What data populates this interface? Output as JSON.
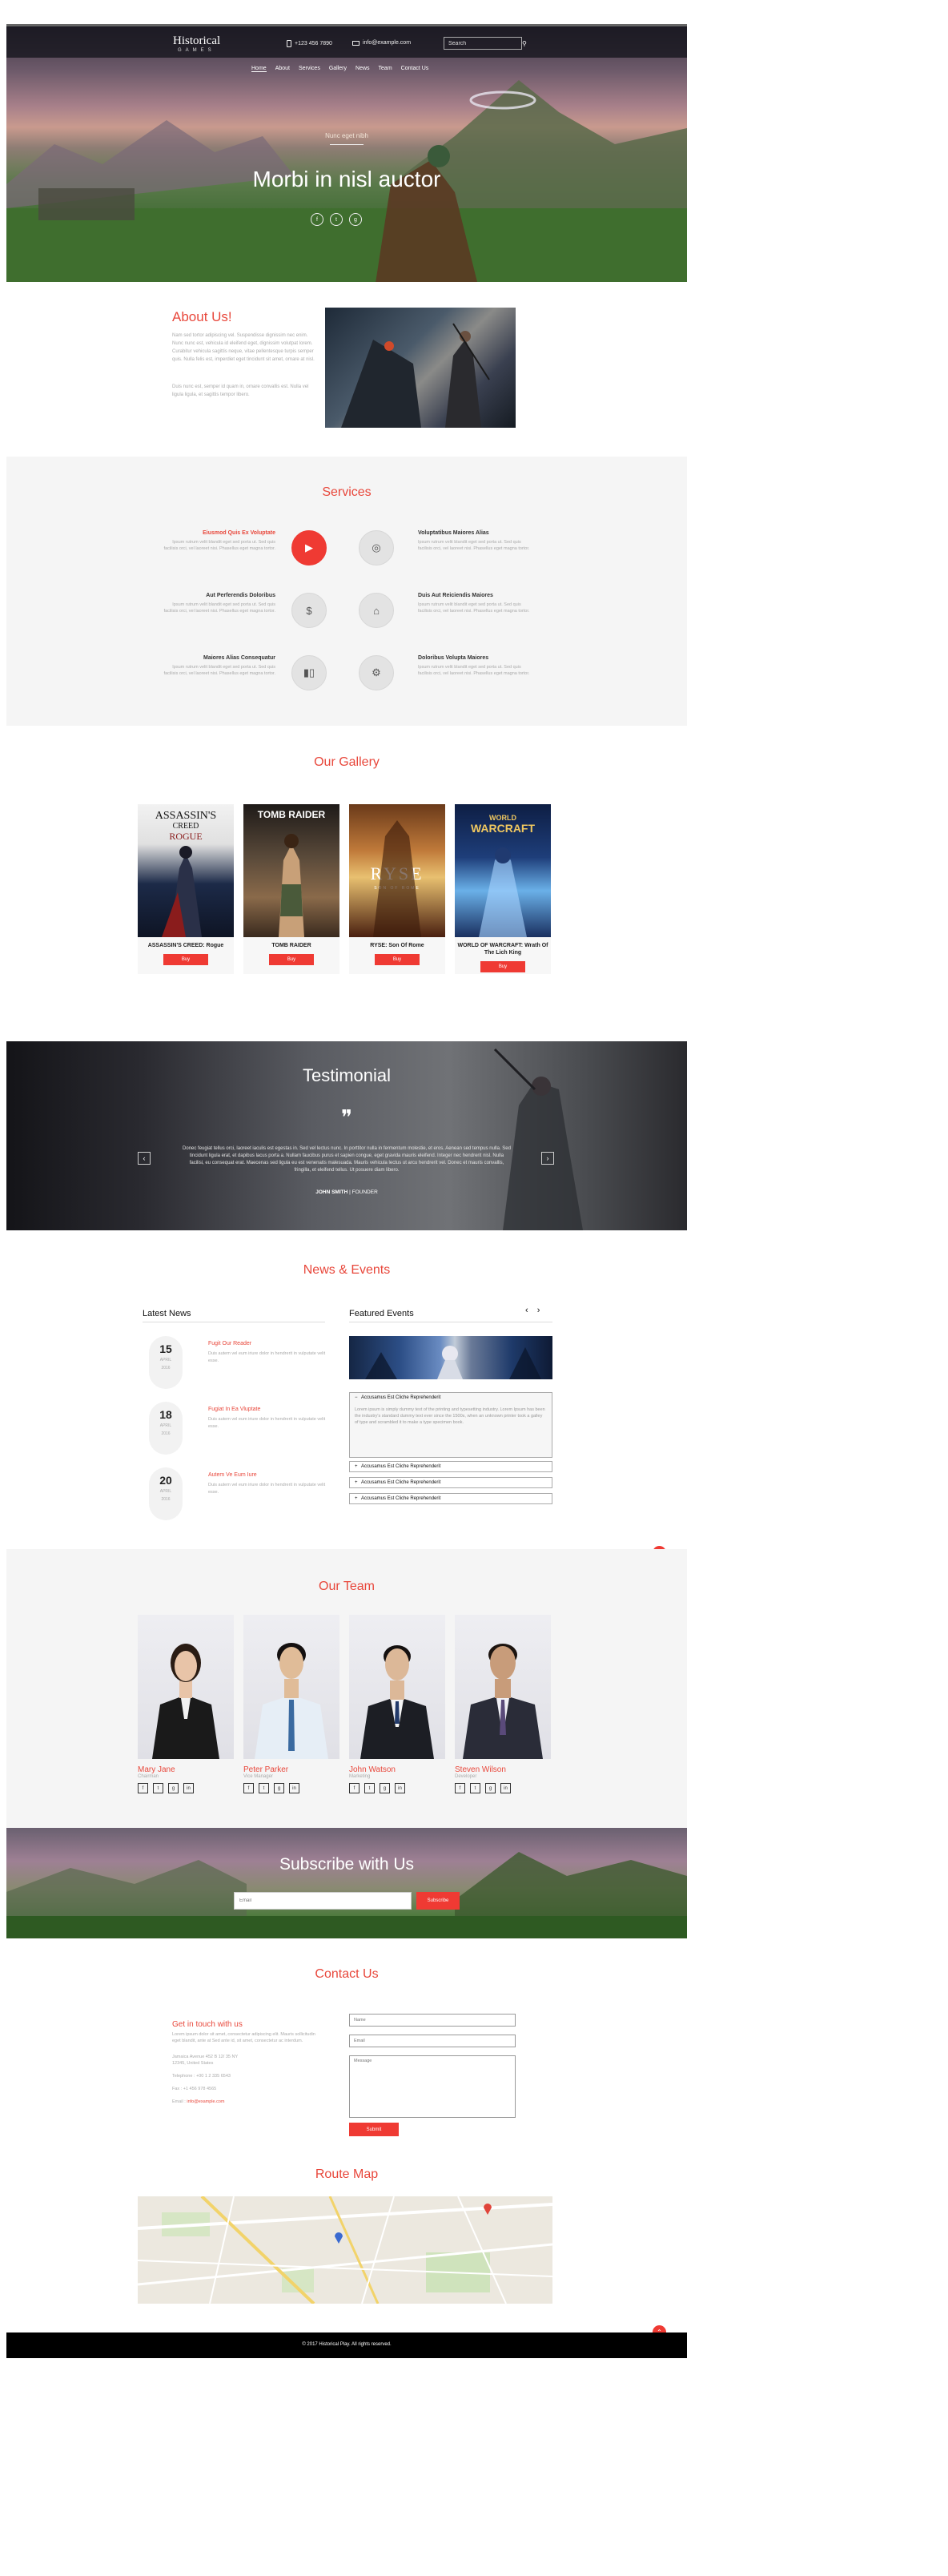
{
  "brand": {
    "name": "Historical",
    "sub": "GAMES"
  },
  "topbar": {
    "phone": "+123 456 7890",
    "email": "info@example.com",
    "search_placeholder": "Search",
    "search_icon": "search-icon"
  },
  "nav": [
    "Home",
    "About",
    "Services",
    "Gallery",
    "News",
    "Team",
    "Contact Us"
  ],
  "hero": {
    "tag": "Nunc eget nibh",
    "title": "Morbi in nisl auctor",
    "social": [
      "f",
      "t",
      "g"
    ]
  },
  "about": {
    "title": "About Us!",
    "p1": "Nam sed tortor adipiscing vel. Suspendisse dignissim nec enim. Nunc nunc est, vehicula id eleifend eget, dignissim volutpat lorem. Curabitur vehicula sagittis neque, vitae pellentesque turpis semper quis. Nulla felis est, imperdiet eget tincidunt sit amet, ornare at nisl.",
    "p2": "Duis nunc est, semper id quam in, ornare convallis est. Nulla vel ligula ligula, et sagittis tempor libero."
  },
  "services": {
    "title": "Services",
    "items": [
      {
        "title": "Eiusmod Quis Ex Voluptate",
        "desc": "Ipsum rutrum velit blandit eget sed porta ut. Sed quis facilisis orci, vel laoreet nisi. Phasellus eget magna tortor.",
        "icon": "play-icon"
      },
      {
        "title": "Voluptatibus Maiores Alias",
        "desc": "Ipsum rutrum velit blandit eget sed porta ut. Sed quis facilisis orci, vel laoreet nisi. Phasellus eget magna tortor.",
        "icon": "target-icon"
      },
      {
        "title": "Aut Perferendis Doloribus",
        "desc": "Ipsum rutrum velit blandit eget sed porta ut. Sed quis facilisis orci, vel laoreet nisi. Phasellus eget magna tortor.",
        "icon": "dollar-icon"
      },
      {
        "title": "Duis Aut Reiciendis Maiores",
        "desc": "Ipsum rutrum velit blandit eget sed porta ut. Sed quis facilisis orci, vel laoreet nisi. Phasellus eget magna tortor.",
        "icon": "home-icon"
      },
      {
        "title": "Maiores Alias Consequatur",
        "desc": "Ipsum rutrum velit blandit eget sed porta ut. Sed quis facilisis orci, vel laoreet nisi. Phasellus eget magna tortor.",
        "icon": "bar-chart-icon"
      },
      {
        "title": "Doloribus Volupta Maiores",
        "desc": "Ipsum rutrum velit blandit eget sed porta ut. Sed quis facilisis orci, vel laoreet nisi. Phasellus eget magna tortor.",
        "icon": "gear-icon"
      }
    ]
  },
  "gallery": {
    "title": "Our Gallery",
    "buy": "Buy",
    "items": [
      {
        "name": "ASSASSIN'S CREED: Rogue",
        "cover": [
          "ASSASSIN'S",
          "CREED",
          "ROGUE"
        ],
        "colors": [
          "#f1f1f1",
          "#1c2a48",
          "#8a1c1c"
        ]
      },
      {
        "name": "TOMB RAIDER",
        "cover": [
          "TOMB RAIDER"
        ],
        "colors": [
          "#2a2020",
          "#7a5a3e",
          "#c6a87a"
        ]
      },
      {
        "name": "RYSE: Son Of Rome",
        "cover": [
          "RYSE",
          "SON OF ROME"
        ],
        "colors": [
          "#3a1e0e",
          "#b06a2a",
          "#e8c070"
        ]
      },
      {
        "name": "WORLD OF WARCRAFT: Wrath Of The Lich King",
        "cover": [
          "WORLD",
          "WARCRAFT"
        ],
        "colors": [
          "#0e1e44",
          "#2a5aa0",
          "#a8d4ff"
        ]
      }
    ]
  },
  "testimonial": {
    "title": "Testimonial",
    "text": "Donec feugiat tellus orci, laoreet iaculis est egestas in. Sed vel lectus nunc. In porttitor nulla in fermentum molestie, et eros. Aenean sed tempus nulla. Sed tincidunt ligula erat, et dapibus lacus porta a. Nullam faucibus purus et sapien congue, eget gravida mauris eleifend. Integer nec hendrerit nisl. Nulla facilisi, eu consequat erat. Maecenas sed ligula eu est venenatis malesuada. Mauris vehicula lectus ut arcu hendrerit vel. Donec et mauris convallis, fringilla, et eleifend tellus. Ut posuere diam libero.",
    "author": "JOHN SMITH",
    "role": "FOUNDER",
    "prev": "‹",
    "next": "›"
  },
  "news": {
    "title": "News & Events",
    "latest": "Latest News",
    "featured": "Featured Events",
    "nav": "‹ ›",
    "items": [
      {
        "day": "15",
        "month": "APRIL",
        "year": "2016",
        "title": "Fugit Our Reader",
        "desc": "Duis autem vel eum iriure dolor in hendrerit in vulputate velit esse."
      },
      {
        "day": "18",
        "month": "APRIL",
        "year": "2016",
        "title": "Fugiat In Ea Vluptate",
        "desc": "Duis autem vel eum iriure dolor in hendrerit in vulputate velit esse."
      },
      {
        "day": "20",
        "month": "APRIL",
        "year": "2016",
        "title": "Autem Ve Eum Iure",
        "desc": "Duis autem vel eum iriure dolor in hendrerit in vulputate velit esse."
      }
    ],
    "accordion": [
      {
        "title": "Accusamus Est Cliche Reprehenderit",
        "open": true,
        "body": "Lorem ipsum is simply dummy text of the printing and typesetting industry. Lorem Ipsum has been the industry's standard dummy text ever since the 1500s, when an unknown printer took a galley of type and scrambled it to make a type specimen book."
      },
      {
        "title": "Accusamus Est Cliche Reprehenderit",
        "open": false
      },
      {
        "title": "Accusamus Est Cliche Reprehenderit",
        "open": false
      },
      {
        "title": "Accusamus Est Cliche Reprehenderit",
        "open": false
      }
    ]
  },
  "team": {
    "title": "Our Team",
    "members": [
      {
        "name": "Mary Jane",
        "role": "Chairman",
        "shirt": "#1a1a1a",
        "skin": "#e8c4a8",
        "hair": "#2a1c14"
      },
      {
        "name": "Peter Parker",
        "role": "Vice Manager",
        "shirt": "#e6eef6",
        "skin": "#e0bc98",
        "hair": "#141010"
      },
      {
        "name": "John Watson",
        "role": "Marketing",
        "shirt": "#1c1e24",
        "skin": "#dcb898",
        "hair": "#141010"
      },
      {
        "name": "Steven Wilson",
        "role": "Developer",
        "shirt": "#2a2c38",
        "skin": "#c89c7a",
        "hair": "#1c1410"
      }
    ],
    "social": [
      "f",
      "t",
      "g",
      "in"
    ]
  },
  "subscribe": {
    "title": "Subscribe with Us",
    "placeholder": "Email",
    "button": "Subscribe"
  },
  "contact": {
    "title": "Contact Us",
    "get": "Get in touch with us",
    "intro": "Lorem ipsum dolor sit amet, consectetur adipiscing elit. Mauris sollicitudin eget blandit, ante at Sed ante id, sit amet, consectetur ac interdum.",
    "address": "Jamaica Avenue 452 B 12/ 35 NY 12345, United States",
    "telephone": "Telephone : +00 1 2 335 6543",
    "fax": "Fax : +1 456 978 4565",
    "email_label": "Email :",
    "email": "info@example.com",
    "name_ph": "Name",
    "email_ph": "Email",
    "message_ph": "Message",
    "submit": "Submit"
  },
  "map": {
    "title": "Route Map"
  },
  "footer": {
    "text": "© 2017 Historical Play. All rights reserved."
  },
  "colors": {
    "accent": "#ef3a33",
    "heading": "#e8473b",
    "footer": "#000000",
    "section_bg": "#f5f5f5"
  }
}
